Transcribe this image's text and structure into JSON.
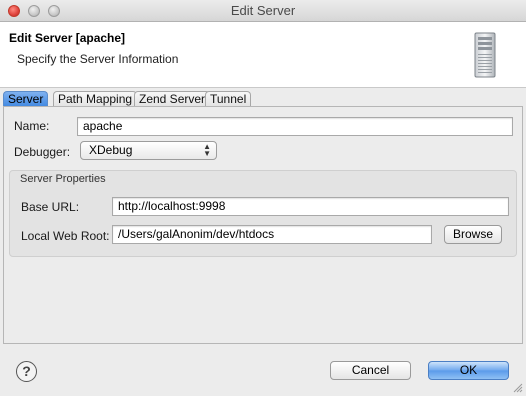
{
  "window": {
    "title": "Edit Server"
  },
  "banner": {
    "title": "Edit Server [apache]",
    "subtitle": "Specify the Server Information",
    "icon": "server-tower-icon"
  },
  "tabs": [
    {
      "label": "Server",
      "active": true
    },
    {
      "label": "Path Mapping",
      "active": false
    },
    {
      "label": "Zend Server",
      "active": false
    },
    {
      "label": "Tunnel",
      "active": false
    }
  ],
  "form": {
    "name_label": "Name:",
    "name_value": "apache",
    "debugger_label": "Debugger:",
    "debugger_value": "XDebug"
  },
  "server_properties": {
    "title": "Server Properties",
    "base_url_label": "Base URL:",
    "base_url_value": "http://localhost:9998",
    "web_root_label": "Local Web Root:",
    "web_root_value": "/Users/galAnonim/dev/htdocs",
    "browse_label": "Browse"
  },
  "footer": {
    "help_glyph": "?",
    "cancel_label": "Cancel",
    "ok_label": "OK"
  },
  "colors": {
    "active_tab": "#3f87e0",
    "primary_button": "#6fa8ee",
    "window_bg": "#ececec"
  }
}
